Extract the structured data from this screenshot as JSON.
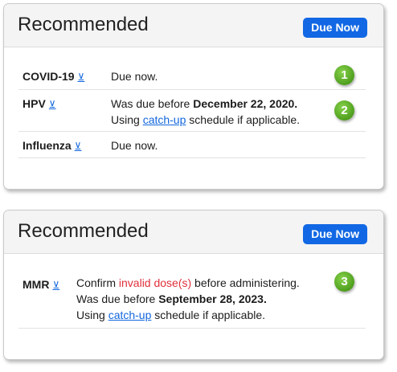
{
  "cards": [
    {
      "title": "Recommended",
      "badge_button": "Due Now",
      "rows": [
        {
          "name": "COVID-19",
          "icon": "download-arrow-icon",
          "text": "Due now.",
          "callout": "1"
        },
        {
          "name": "HPV",
          "icon": "download-arrow-icon",
          "line1_prefix": "Was due before ",
          "line1_date": "December 22, 2020.",
          "line2_prefix": "Using ",
          "line2_link": "catch-up",
          "line2_suffix": " schedule if applicable.",
          "callout": "2"
        },
        {
          "name": "Influenza",
          "icon": "download-arrow-icon",
          "text": "Due now."
        }
      ]
    },
    {
      "title": "Recommended",
      "badge_button": "Due Now",
      "rows": [
        {
          "name": "MMR",
          "icon": "download-arrow-icon",
          "line1_prefix": "Confirm ",
          "line1_red": "invalid dose(s)",
          "line1_suffix": " before administering.",
          "line2_prefix": "Was due before ",
          "line2_date": "September 28, 2023.",
          "line3_prefix": "Using ",
          "line3_link": "catch-up",
          "line3_suffix": " schedule if applicable.",
          "callout": "3"
        }
      ]
    }
  ],
  "link_glyph": "⊻",
  "colors": {
    "accent": "#1268e4",
    "link": "#1166dd",
    "warning": "#e0303a",
    "callout": "#5aa825"
  }
}
